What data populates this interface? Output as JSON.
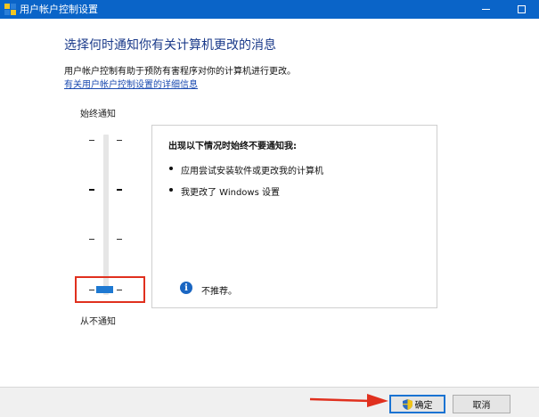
{
  "window": {
    "title": "用户帐户控制设置",
    "minimize_icon": "minimize-icon",
    "maximize_icon": "maximize-icon"
  },
  "main": {
    "heading": "选择何时通知你有关计算机更改的消息",
    "description": "用户帐户控制有助于预防有害程序对你的计算机进行更改。",
    "more_info_link": "有关用户帐户控制设置的详细信息"
  },
  "slider": {
    "top_label": "始终通知",
    "bottom_label": "从不通知",
    "levels": 4,
    "selected_level": 1,
    "thumb_color": "#1e79d2"
  },
  "info_panel": {
    "title": "出现以下情况时始终不要通知我:",
    "bullets": [
      "应用尝试安装软件或更改我的计算机",
      "我更改了 Windows 设置"
    ],
    "note": "不推荐。",
    "note_icon": "info-icon"
  },
  "buttons": {
    "ok": "确定",
    "cancel": "取消",
    "ok_icon": "uac-shield-icon"
  },
  "annotations": {
    "highlight_color": "#e0301e",
    "accent": "#0a64c8"
  }
}
